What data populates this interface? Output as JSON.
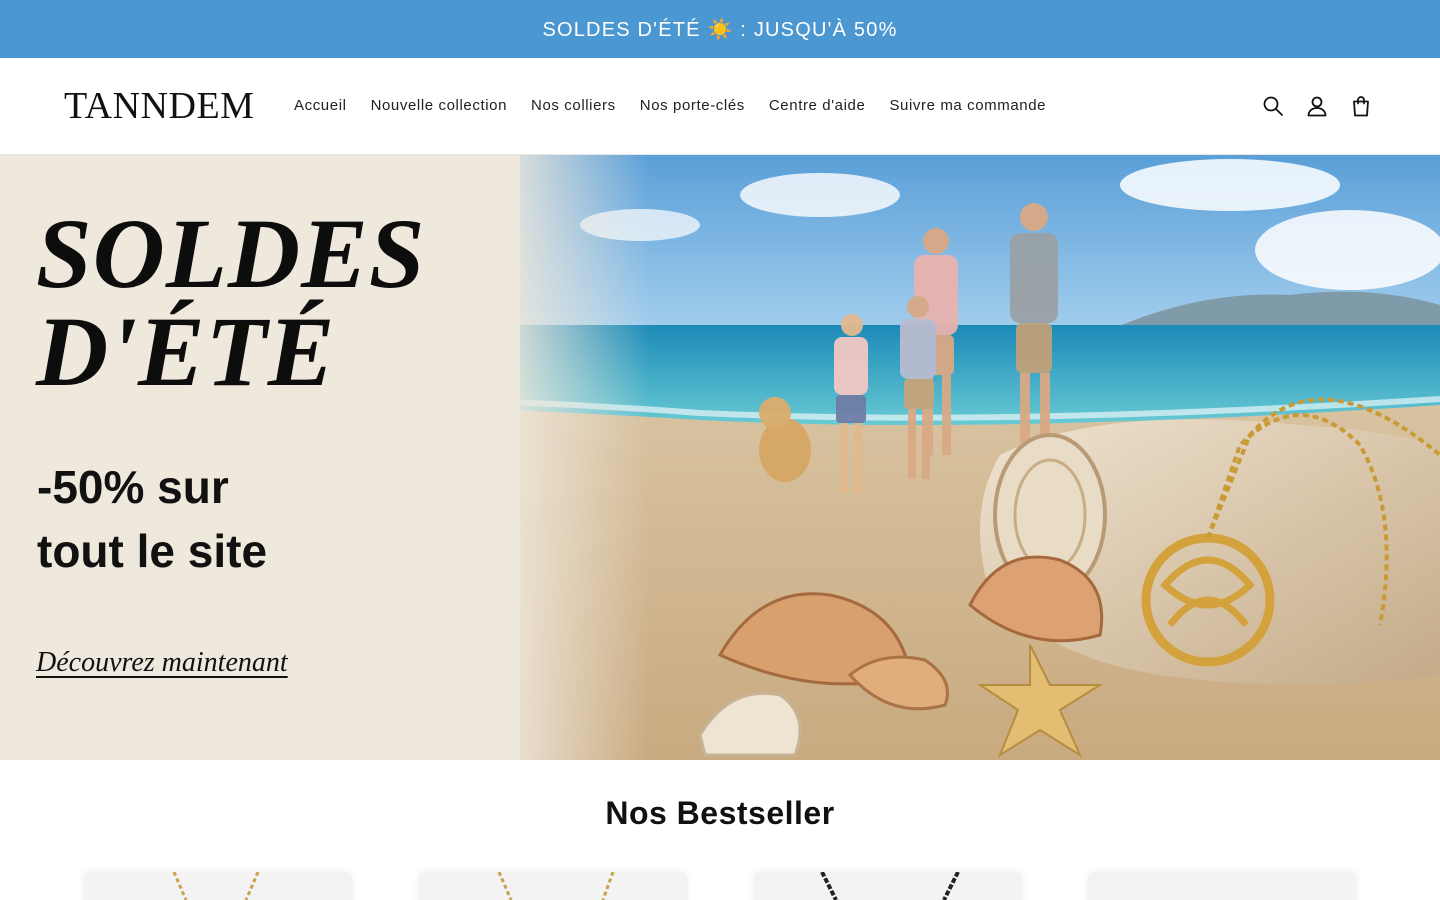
{
  "announcement": {
    "text": "SOLDES D'ÉTÉ ☀️ : JUSQU'À 50%"
  },
  "header": {
    "logo": "TANNDEM",
    "nav": [
      {
        "label": "Accueil"
      },
      {
        "label": "Nouvelle collection"
      },
      {
        "label": "Nos colliers"
      },
      {
        "label": "Nos porte-clés"
      },
      {
        "label": "Centre d'aide"
      },
      {
        "label": "Suivre ma commande"
      }
    ],
    "icons": [
      "search-icon",
      "account-icon",
      "cart-icon"
    ]
  },
  "hero": {
    "title_line1": "SOLDES",
    "title_line2": "D'ÉTÉ",
    "subtitle_line1": "-50% sur",
    "subtitle_line2": "tout le site",
    "cta": "Découvrez maintenant"
  },
  "bestseller": {
    "title": "Nos Bestseller",
    "products": [
      {
        "chain_color": "#c9a24a"
      },
      {
        "chain_color": "#c9a24a"
      },
      {
        "chain_color": "#222222"
      },
      {
        "chain_color": "#dddddd"
      }
    ]
  },
  "colors": {
    "announcement_bg": "#4b97d1",
    "hero_bg": "#efe8dc",
    "text": "#111111"
  }
}
